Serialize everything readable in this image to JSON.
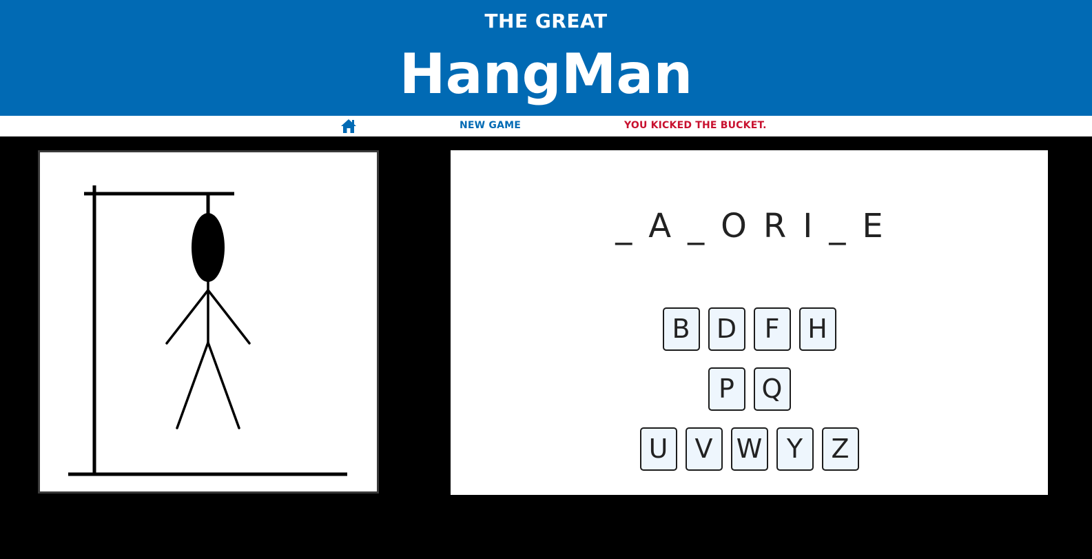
{
  "header": {
    "subtitle": "THE GREAT",
    "title": "HangMan"
  },
  "nav": {
    "home_icon": "home-icon",
    "new_game_label": "NEW GAME",
    "status_text": "YOU KICKED THE BUCKET."
  },
  "colors": {
    "brand_blue": "#016ab4",
    "status_red": "#c8102e",
    "key_bg": "#eef6fd"
  },
  "game": {
    "word_slots": [
      "_",
      "A",
      "_",
      "O",
      "R",
      "I",
      "_",
      "E"
    ],
    "wrong_guesses_shown": 6,
    "keyboard_rows": [
      [
        "B",
        "D",
        "F",
        "H"
      ],
      [
        "P",
        "Q"
      ],
      [
        "U",
        "V",
        "W",
        "Y",
        "Z"
      ]
    ]
  }
}
